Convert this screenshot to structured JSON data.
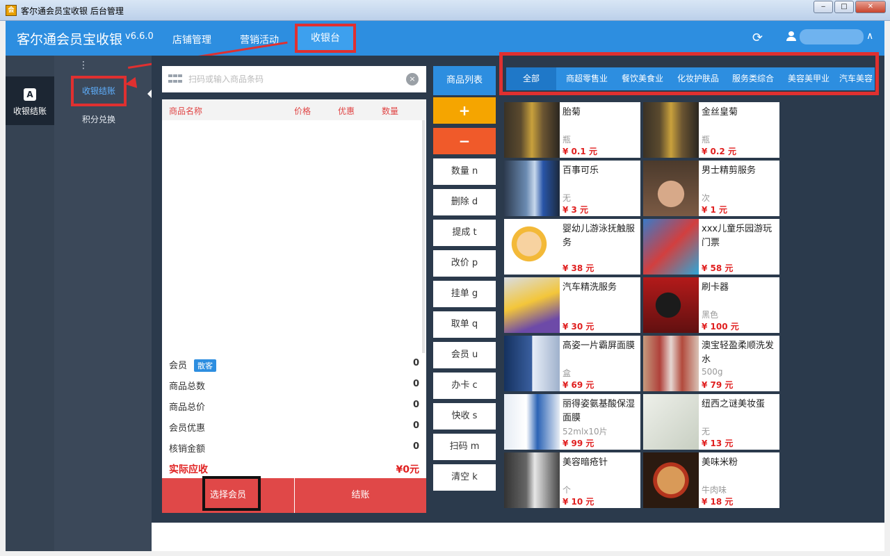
{
  "window": {
    "title": "客尔通会员宝收银 后台管理",
    "app_icon": "app-logo-icon",
    "minimize": "‒",
    "maximize": "□",
    "close": "✕"
  },
  "topnav": {
    "brand": "客尔通会员宝收银",
    "version": "v6.6.0",
    "items": [
      "店铺管理",
      "营销活动",
      "收银台"
    ],
    "refresh_icon": "refresh-icon",
    "user_icon": "user-icon",
    "user_name": "",
    "chevron_up": "∧"
  },
  "leftbar": {
    "item_label": "收银结账",
    "item_icon": "A"
  },
  "subbar": {
    "items": [
      "收银结账",
      "积分兑换"
    ],
    "dots": "⋮"
  },
  "search": {
    "placeholder": "扫码或输入商品条码",
    "clear_icon": "×"
  },
  "cart": {
    "columns": [
      "商品名称",
      "价格",
      "优惠",
      "数量"
    ],
    "summary": [
      {
        "label": "会员",
        "badge": "散客",
        "value": "0"
      },
      {
        "label": "商品总数",
        "value": "0"
      },
      {
        "label": "商品总价",
        "value": "0"
      },
      {
        "label": "会员优惠",
        "value": "0"
      },
      {
        "label": "核销金额",
        "value": "0"
      },
      {
        "label": "实际应收",
        "value": "¥0元"
      }
    ],
    "select_member": "选择会员",
    "checkout": "结账"
  },
  "functions": {
    "product_list": "商品列表",
    "plus": "+",
    "minus": "−",
    "buttons": [
      "数量 n",
      "删除 d",
      "提成 t",
      "改价 p",
      "挂单 g",
      "取单 q",
      "会员 u",
      "办卡 c",
      "快收 s",
      "扫码 m",
      "清空 k"
    ]
  },
  "categories": [
    "全部",
    "商超零售业",
    "餐饮美食业",
    "化妆护肤品",
    "服务类综合",
    "美容美甲业",
    "汽车美容"
  ],
  "products": [
    {
      "name": "胎菊",
      "unit": "瓶",
      "price": "¥ 0.1 元",
      "img": "jar"
    },
    {
      "name": "金丝皇菊",
      "unit": "瓶",
      "price": "¥ 0.2 元",
      "img": "jar"
    },
    {
      "name": "百事可乐",
      "unit": "无",
      "price": "¥ 3 元",
      "img": "bottle"
    },
    {
      "name": "男士精剪服务",
      "unit": "次",
      "price": "¥ 1 元",
      "img": "face"
    },
    {
      "name": "婴幼儿游泳抚触服务",
      "unit": "",
      "price": "¥ 38 元",
      "img": "baby"
    },
    {
      "name": "xxx儿童乐园游玩门票",
      "unit": "",
      "price": "¥ 58 元",
      "img": "park"
    },
    {
      "name": "汽车精洗服务",
      "unit": "",
      "price": "¥ 30 元",
      "img": "car"
    },
    {
      "name": "刷卡器",
      "unit": "黑色",
      "price": "¥ 100 元",
      "img": "pos"
    },
    {
      "name": "高姿一片霸屏面膜",
      "unit": "盒",
      "price": "¥ 69 元",
      "img": "mask"
    },
    {
      "name": "澳宝轻盈柔顺洗发水",
      "unit": "500g",
      "price": "¥ 79 元",
      "img": "shampoo"
    },
    {
      "name": "丽得姿氨基酸保湿面膜",
      "unit": "52mlx10片",
      "price": "¥ 99 元",
      "img": "mask2"
    },
    {
      "name": "纽西之谜美妆蛋",
      "unit": "无",
      "price": "¥ 13 元",
      "img": "box"
    },
    {
      "name": "美容暗疮针",
      "unit": "个",
      "price": "¥ 10 元",
      "img": "needle"
    },
    {
      "name": "美味米粉",
      "unit": "牛肉味",
      "price": "¥ 18 元",
      "img": "noodle"
    }
  ],
  "colors": {
    "accent": "#2d8ee0",
    "danger": "#e04848",
    "highlight_box": "#e03030",
    "background": "#2b3a4c"
  }
}
